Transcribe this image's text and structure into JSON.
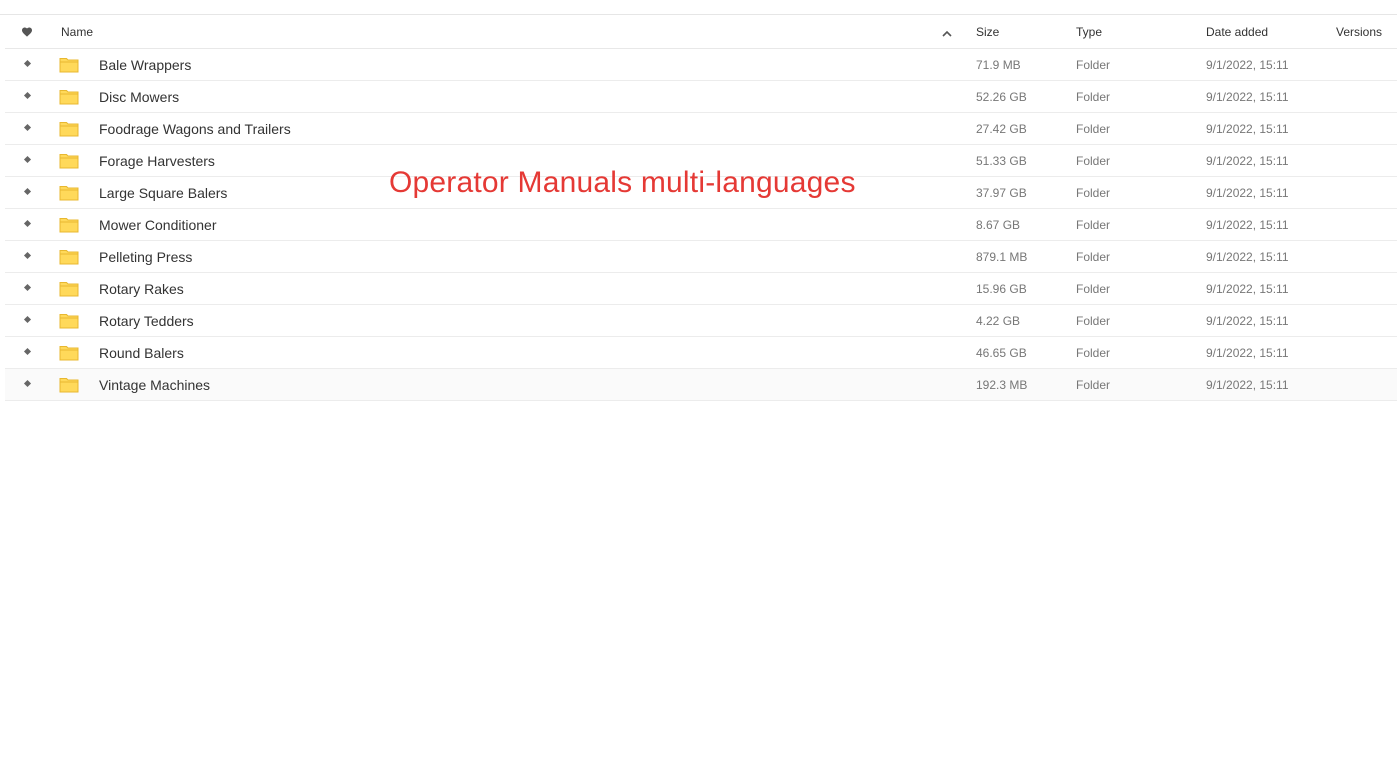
{
  "overlay_title": "Operator Manuals multi-languages",
  "table": {
    "columns": {
      "name": "Name",
      "size": "Size",
      "type": "Type",
      "date": "Date added",
      "versions": "Versions"
    },
    "favorite_icon": "heart-icon",
    "sort_icon": "chevron-up-icon",
    "rows": [
      {
        "name": "Bale Wrappers",
        "size": "71.9 MB",
        "type": "Folder",
        "date": "9/1/2022, 15:11",
        "versions": ""
      },
      {
        "name": "Disc Mowers",
        "size": "52.26 GB",
        "type": "Folder",
        "date": "9/1/2022, 15:11",
        "versions": ""
      },
      {
        "name": "Foodrage Wagons and Trailers",
        "size": "27.42 GB",
        "type": "Folder",
        "date": "9/1/2022, 15:11",
        "versions": ""
      },
      {
        "name": "Forage Harvesters",
        "size": "51.33 GB",
        "type": "Folder",
        "date": "9/1/2022, 15:11",
        "versions": ""
      },
      {
        "name": "Large Square Balers",
        "size": "37.97 GB",
        "type": "Folder",
        "date": "9/1/2022, 15:11",
        "versions": ""
      },
      {
        "name": "Mower Conditioner",
        "size": "8.67 GB",
        "type": "Folder",
        "date": "9/1/2022, 15:11",
        "versions": ""
      },
      {
        "name": "Pelleting Press",
        "size": "879.1 MB",
        "type": "Folder",
        "date": "9/1/2022, 15:11",
        "versions": ""
      },
      {
        "name": "Rotary Rakes",
        "size": "15.96 GB",
        "type": "Folder",
        "date": "9/1/2022, 15:11",
        "versions": ""
      },
      {
        "name": "Rotary Tedders",
        "size": "4.22 GB",
        "type": "Folder",
        "date": "9/1/2022, 15:11",
        "versions": ""
      },
      {
        "name": "Round Balers",
        "size": "46.65 GB",
        "type": "Folder",
        "date": "9/1/2022, 15:11",
        "versions": ""
      },
      {
        "name": "Vintage Machines",
        "size": "192.3 MB",
        "type": "Folder",
        "date": "9/1/2022, 15:11",
        "versions": ""
      }
    ]
  },
  "colors": {
    "overlay_text": "#e53935",
    "folder_fill": "#ffd95a",
    "folder_stroke": "#e8b830"
  }
}
